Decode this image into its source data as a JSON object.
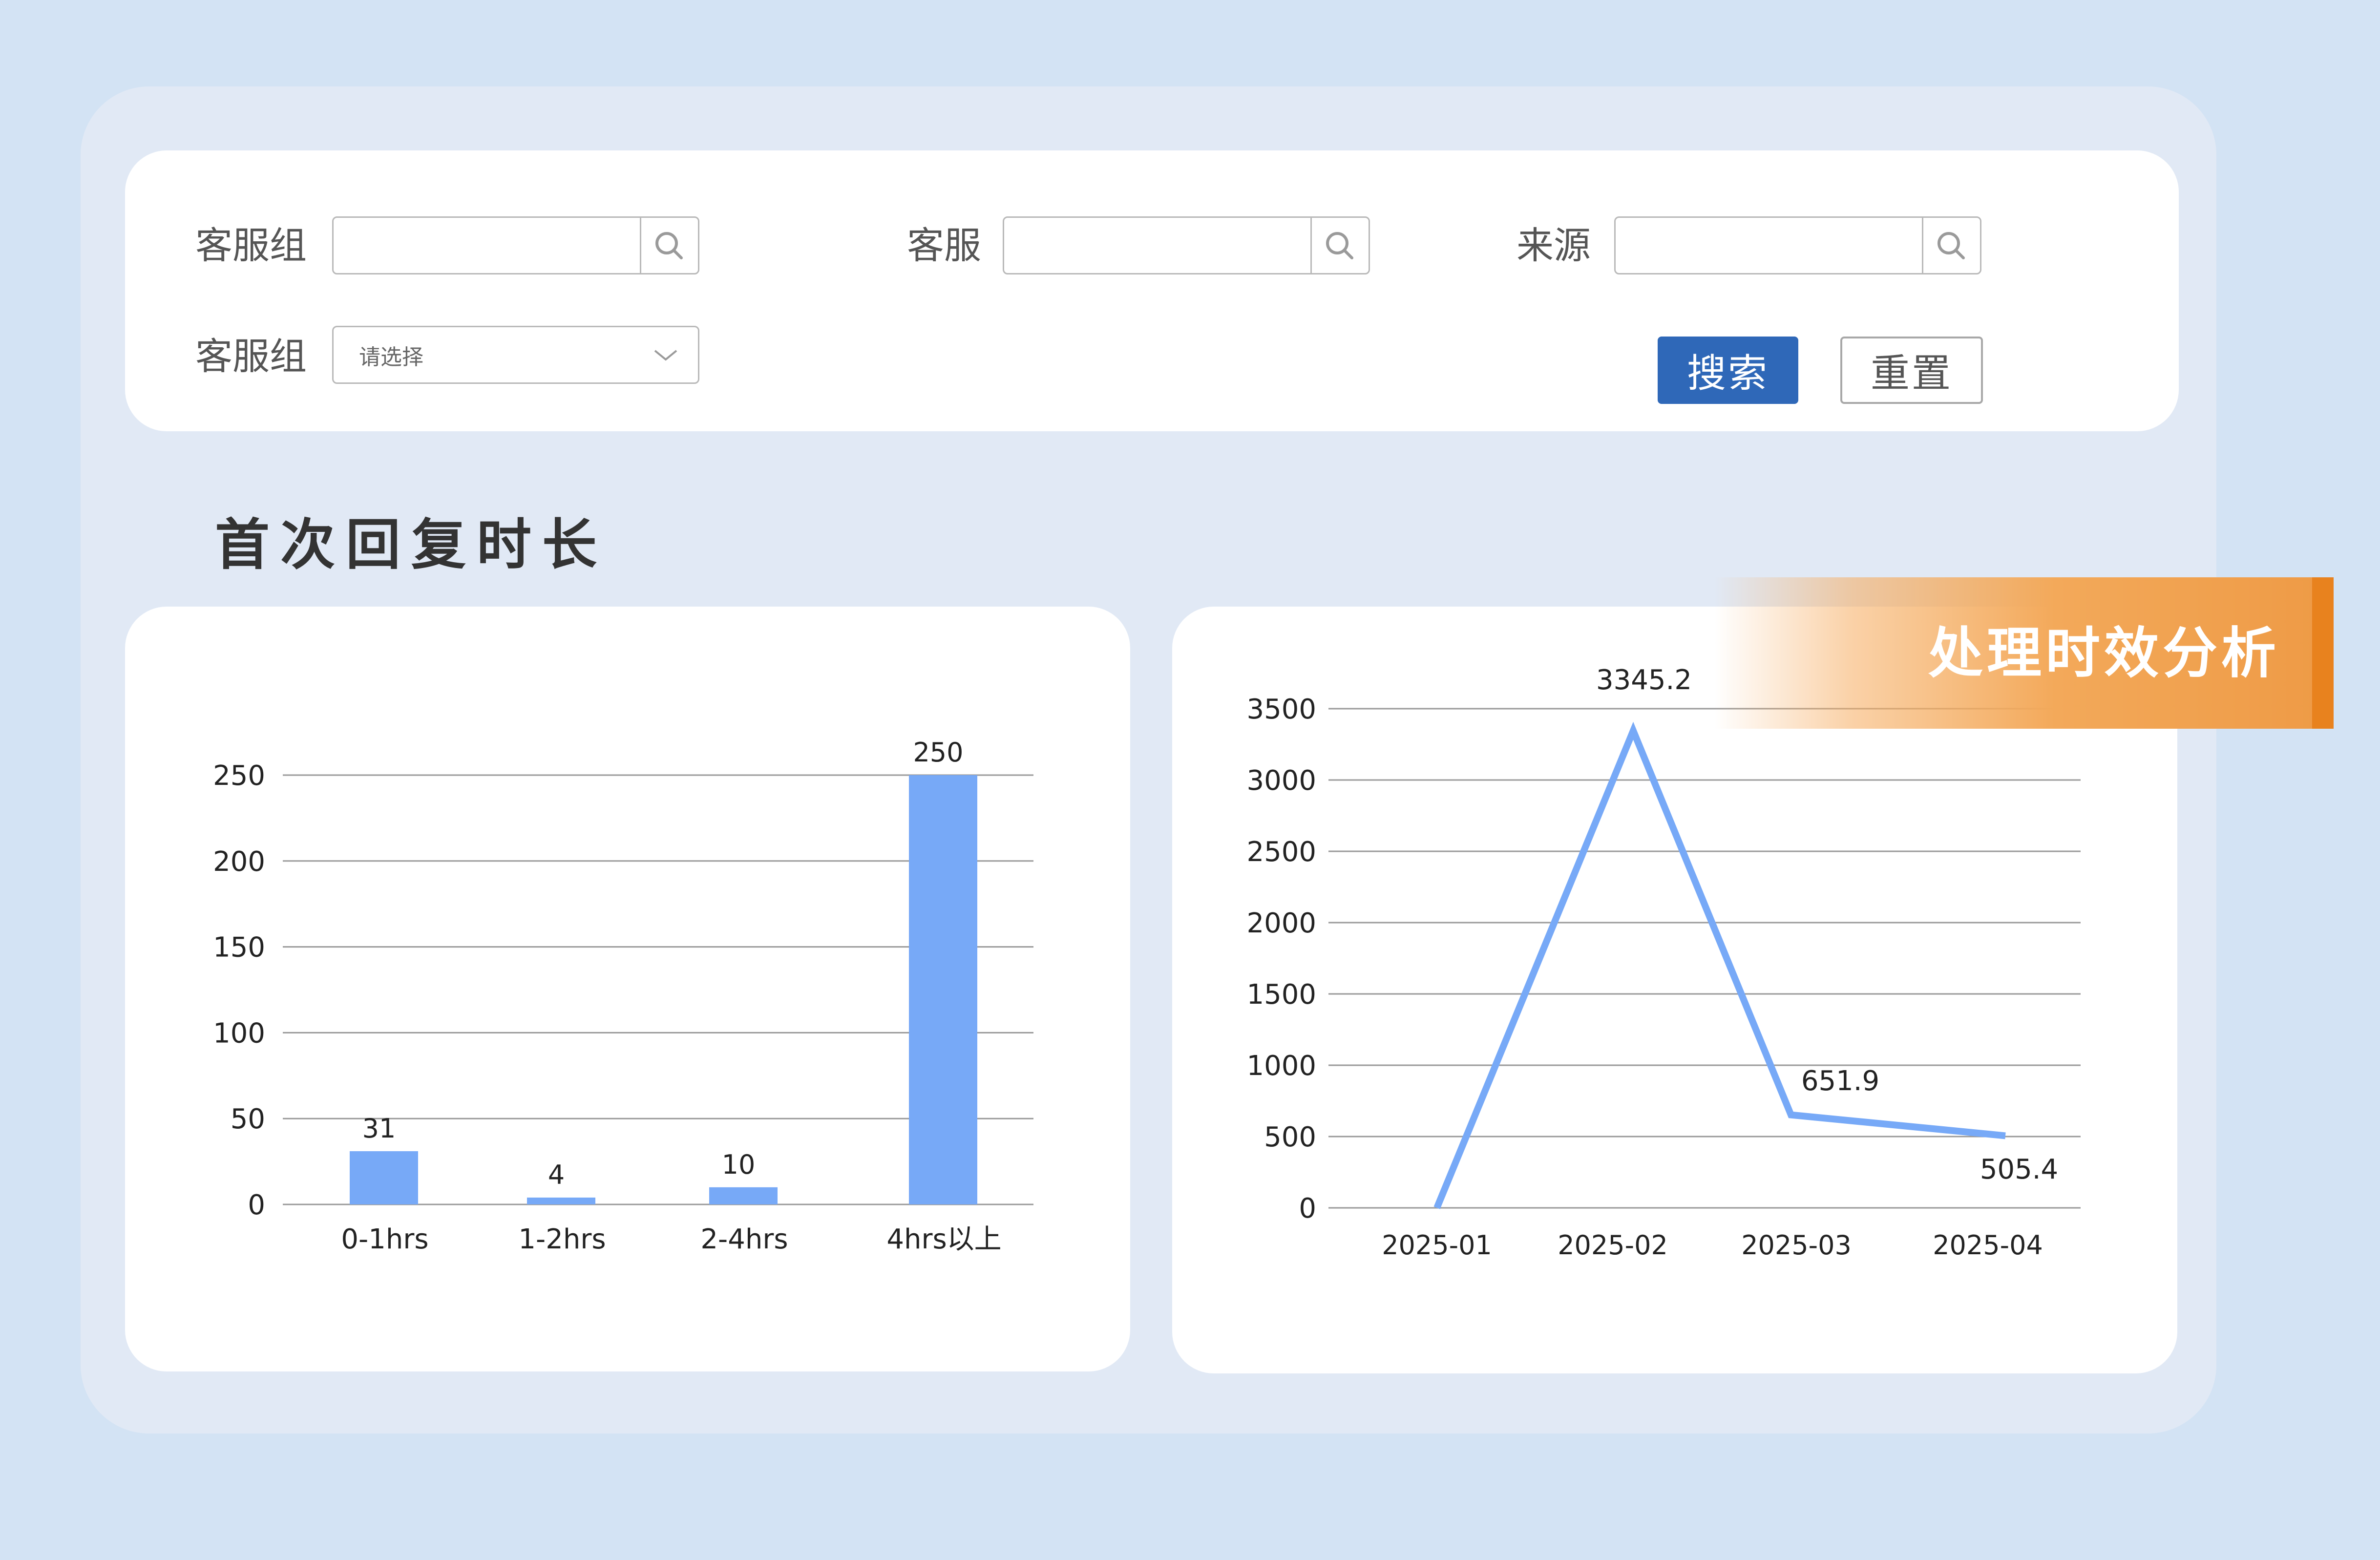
{
  "filters": {
    "group_label": "客服组",
    "agent_label": "客服",
    "source_label": "来源",
    "group_select_label": "客服组",
    "group_select_placeholder": "请选择",
    "search_button": "搜索",
    "reset_button": "重置"
  },
  "section_title": "首次回复时长",
  "banner": {
    "text": "处理时效分析"
  },
  "colors": {
    "accent": "#2f68b8",
    "bar": "#77a9f7",
    "line": "#77a9f7",
    "banner": "#f0a04d"
  },
  "chart_data": [
    {
      "type": "bar",
      "categories": [
        "0-1hrs",
        "1-2hrs",
        "2-4hrs",
        "4hrs以上"
      ],
      "values": [
        31,
        4,
        10,
        250
      ],
      "ylim": [
        0,
        250
      ],
      "yticks": [
        0,
        50,
        100,
        150,
        200,
        250
      ],
      "grid": true
    },
    {
      "type": "line",
      "categories": [
        "2025-01",
        "2025-02",
        "2025-03",
        "2025-04"
      ],
      "values": [
        0,
        3345.2,
        651.9,
        505.4
      ],
      "labels": [
        "",
        "3345.2",
        "651.9",
        "505.4"
      ],
      "ylim": [
        0,
        3500
      ],
      "yticks": [
        0,
        500,
        1000,
        1500,
        2000,
        2500,
        3000,
        3500
      ],
      "grid": true
    }
  ]
}
